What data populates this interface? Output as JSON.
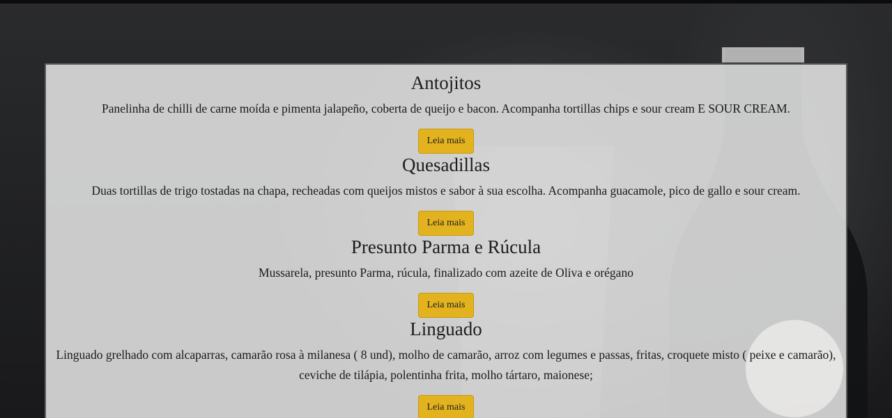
{
  "menu_items": [
    {
      "title": "Antojitos",
      "description": "Panelinha de chilli de carne moída e pimenta jalapeño, coberta de queijo e bacon. Acompanha tortillas chips e sour cream E SOUR CREAM.",
      "button_label": "Leia mais"
    },
    {
      "title": "Quesadillas",
      "description": "Duas tortillas de trigo tostadas na chapa, recheadas com queijos mistos e sabor à sua escolha. Acompanha guacamole, pico de gallo e sour cream.",
      "button_label": "Leia mais"
    },
    {
      "title": "Presunto Parma e Rúcula",
      "description": "Mussarela, presunto Parma, rúcula, finalizado com azeite de Oliva e orégano",
      "button_label": "Leia mais"
    },
    {
      "title": "Linguado",
      "description": "Linguado grelhado com alcaparras, camarão rosa à milanesa ( 8 und), molho de camarão, arroz com legumes e passas, fritas, croquete misto ( peixe e camarão), ceviche de tilápia, polentinha frita, molho tártaro, maionese;",
      "button_label": "Leia mais"
    }
  ],
  "colors": {
    "button_bg": "#e2b21f",
    "panel_bg": "#e8e8e8",
    "background": "#1c1d1f"
  }
}
